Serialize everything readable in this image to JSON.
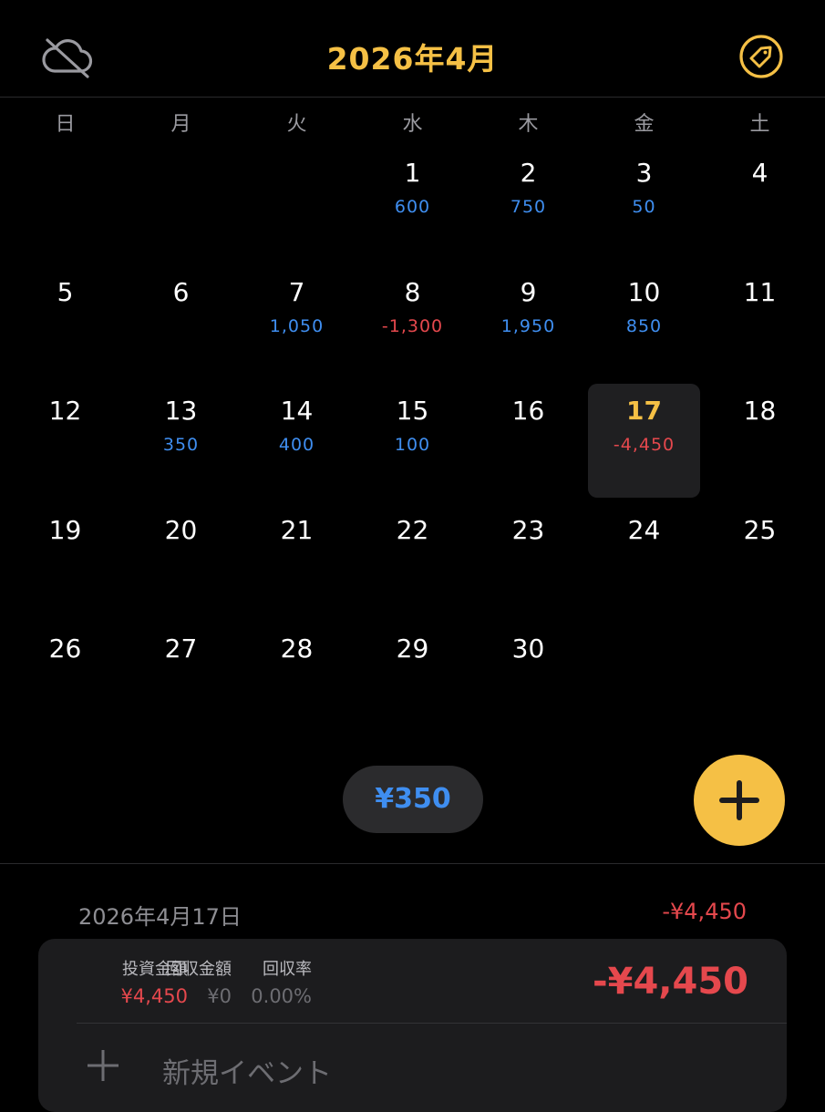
{
  "header": {
    "title": "2026年4月",
    "left_icon": "cloud-slash-icon",
    "right_icon": "tag-icon"
  },
  "calendar": {
    "weekdays": [
      "日",
      "月",
      "火",
      "水",
      "木",
      "金",
      "土"
    ],
    "leading_blanks": 3,
    "selected_day": "17",
    "days": [
      {
        "day": "1",
        "amount": "600",
        "type": "pos"
      },
      {
        "day": "2",
        "amount": "750",
        "type": "pos"
      },
      {
        "day": "3",
        "amount": "50",
        "type": "pos"
      },
      {
        "day": "4",
        "amount": "",
        "type": ""
      },
      {
        "day": "5",
        "amount": "",
        "type": ""
      },
      {
        "day": "6",
        "amount": "",
        "type": ""
      },
      {
        "day": "7",
        "amount": "1,050",
        "type": "pos"
      },
      {
        "day": "8",
        "amount": "-1,300",
        "type": "neg"
      },
      {
        "day": "9",
        "amount": "1,950",
        "type": "pos"
      },
      {
        "day": "10",
        "amount": "850",
        "type": "pos"
      },
      {
        "day": "11",
        "amount": "",
        "type": ""
      },
      {
        "day": "12",
        "amount": "",
        "type": ""
      },
      {
        "day": "13",
        "amount": "350",
        "type": "pos"
      },
      {
        "day": "14",
        "amount": "400",
        "type": "pos"
      },
      {
        "day": "15",
        "amount": "100",
        "type": "pos"
      },
      {
        "day": "16",
        "amount": "",
        "type": ""
      },
      {
        "day": "17",
        "amount": "-4,450",
        "type": "neg"
      },
      {
        "day": "18",
        "amount": "",
        "type": ""
      },
      {
        "day": "19",
        "amount": "",
        "type": ""
      },
      {
        "day": "20",
        "amount": "",
        "type": ""
      },
      {
        "day": "21",
        "amount": "",
        "type": ""
      },
      {
        "day": "22",
        "amount": "",
        "type": ""
      },
      {
        "day": "23",
        "amount": "",
        "type": ""
      },
      {
        "day": "24",
        "amount": "",
        "type": ""
      },
      {
        "day": "25",
        "amount": "",
        "type": ""
      },
      {
        "day": "26",
        "amount": "",
        "type": ""
      },
      {
        "day": "27",
        "amount": "",
        "type": ""
      },
      {
        "day": "28",
        "amount": "",
        "type": ""
      },
      {
        "day": "29",
        "amount": "",
        "type": ""
      },
      {
        "day": "30",
        "amount": "",
        "type": ""
      }
    ]
  },
  "month_total": "¥350",
  "add_button_icon": "plus-icon",
  "detail": {
    "date": "2026年4月17日",
    "total": "-¥4,450",
    "invested_label": "投資金額",
    "invested_value": "¥4,450",
    "returned_label": "回収金額",
    "returned_value": "¥0",
    "rate_label": "回収率",
    "rate_value": "0.00%",
    "big_amount": "-¥4,450",
    "new_event_label": "新規イベント"
  },
  "colors": {
    "accent": "#f5c045",
    "positive": "#3f8ef0",
    "negative": "#e5484d",
    "background": "#000000",
    "card": "#1c1c1e"
  }
}
